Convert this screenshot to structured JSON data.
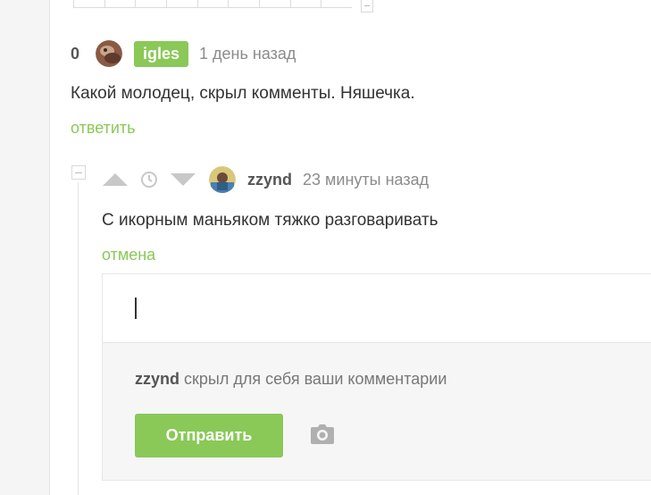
{
  "comment1": {
    "rating": "0",
    "username": "igles",
    "time": "1 день назад",
    "text": "Какой молодец, скрыл комменты. Няшечка.",
    "reply_label": "ответить"
  },
  "comment2": {
    "username": "zzynd",
    "time": "23 минуты назад",
    "text": "С икорным маньяком тяжко разговаривать",
    "cancel_label": "отмена"
  },
  "reply_form": {
    "notice_user": "zzynd",
    "notice_text": " скрыл для себя ваши комментарии",
    "submit_label": "Отправить"
  },
  "colors": {
    "accent": "#8ac858",
    "muted": "#8b8b8b"
  },
  "icons": [
    "collapse-icon",
    "upvote-icon",
    "clock-icon",
    "downvote-icon",
    "camera-icon"
  ]
}
